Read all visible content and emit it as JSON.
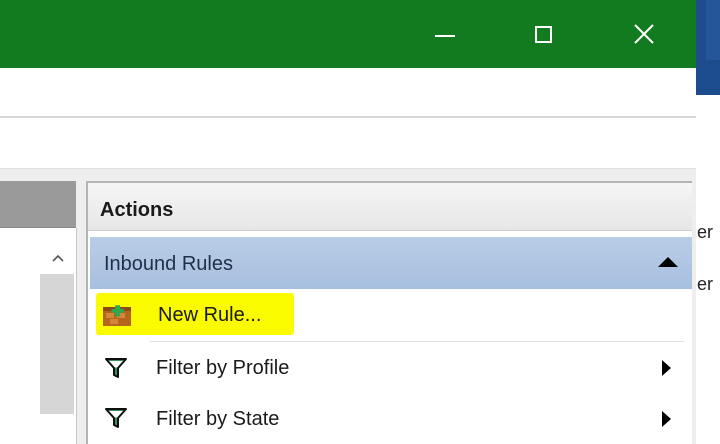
{
  "window": {
    "titlebar_color": "#127b1f",
    "controls": [
      "minimize-icon",
      "maximize-icon",
      "close-icon"
    ]
  },
  "background_window": {
    "text_1": "er",
    "text_2": "er"
  },
  "actions": {
    "title": "Actions",
    "section": {
      "label": "Inbound Rules",
      "expanded": true
    },
    "items": [
      {
        "label": "New Rule...",
        "icon": "new-rule-icon",
        "highlighted": true,
        "submenu": false
      },
      {
        "label": "Filter by Profile",
        "icon": "filter-icon",
        "submenu": true
      },
      {
        "label": "Filter by State",
        "icon": "filter-icon",
        "submenu": true
      }
    ],
    "highlight_color": "#fbfb00"
  }
}
